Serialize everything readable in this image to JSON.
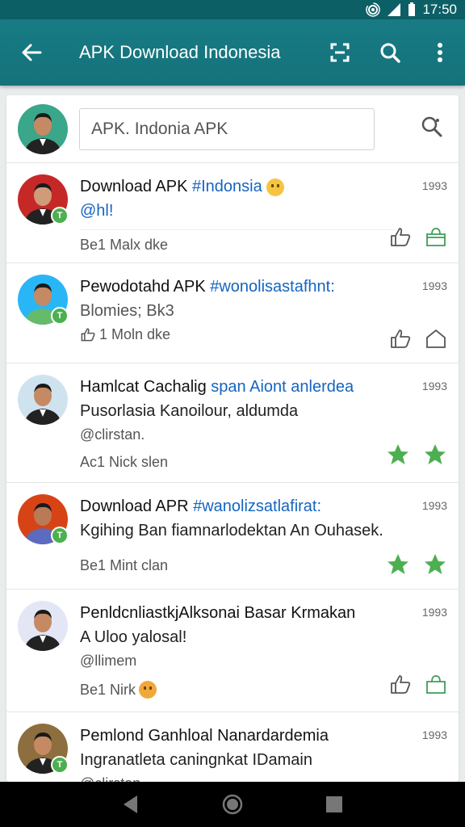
{
  "status_bar": {
    "time": "17:50"
  },
  "app_bar": {
    "title": "APK Download Indonesia"
  },
  "search": {
    "placeholder": "APK. Indonia APK"
  },
  "colors": {
    "primary": "#187b84",
    "status": "#0d5f66",
    "accent_green": "#4caf50",
    "link_blue": "#1565c0"
  },
  "posts": [
    {
      "title": "Download APK ",
      "tag": "#Indonsia",
      "handle": "@hl!",
      "meta": "Be1 Malx dke",
      "time": "1993",
      "actions": [
        "like-icon",
        "bag-icon"
      ]
    },
    {
      "title": "Pewodotahd APK ",
      "tag": "#wonolisastafhnt:",
      "line2": "Blomies; Bk3",
      "meta": "1 Moln dke",
      "time": "1993",
      "actions": [
        "like-icon",
        "home-icon"
      ]
    },
    {
      "title": "Hamlcat Cachalig ",
      "tag": "span Aiont anlerdea",
      "line2": "Pusorlasia Kanoilour, aldumda",
      "handle": "@clirstan.",
      "meta": "Ac1 Nick slen",
      "time": "1993",
      "actions": [
        "star-icon",
        "star-icon"
      ]
    },
    {
      "title": "Download APR ",
      "tag": "#wanolizsatlafirat:",
      "line2": "Kgihing Ban fiamnarlodektan An Ouhasek.",
      "meta": "Be1 Mint clan",
      "time": "1993",
      "actions": [
        "star-icon",
        "star-icon"
      ]
    },
    {
      "title": "PenldcnliastkjAlksonai Basar Krmakan",
      "line2": "A Uloo yalosal!",
      "handle": "@llimem",
      "meta": "Be1 Nirk",
      "time": "1993",
      "actions": [
        "like-icon",
        "bag-icon"
      ]
    },
    {
      "title": "Pemlond Ganhloal Nanardardemia",
      "line2": "Ingranatleta caningnkat IDamain",
      "handle": "@clirstan",
      "time": "1993"
    }
  ]
}
